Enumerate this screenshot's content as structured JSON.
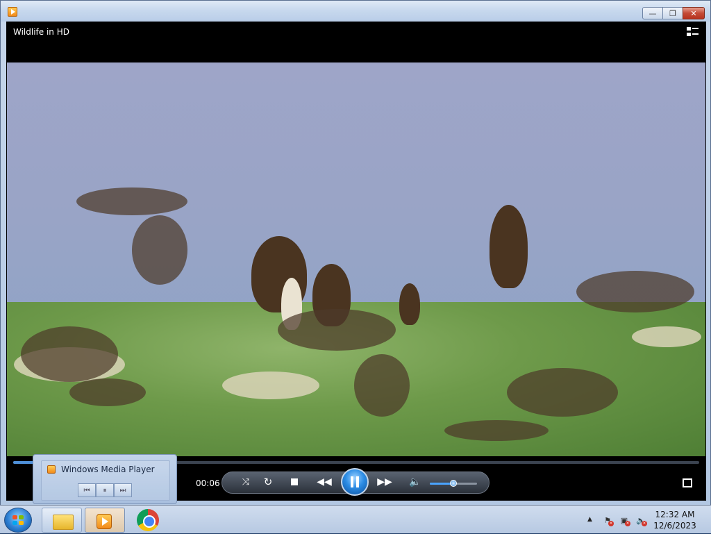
{
  "window": {
    "title": "Wildlife in HD",
    "minimize_label": "—",
    "maximize_label": "❐",
    "close_label": "✕"
  },
  "player": {
    "current_time": "00:06",
    "progress": 0.03,
    "volume": 0.5,
    "icons": [
      "switch-to-library-icon",
      "shuffle-icon",
      "repeat-icon",
      "stop-icon",
      "previous-icon",
      "pause-icon",
      "next-icon",
      "speaker-icon",
      "fullscreen-icon"
    ]
  },
  "thumbnail": {
    "title": "Windows Media Player",
    "prev_label": "⏮",
    "pause_label": "⏸",
    "next_label": "⏭"
  },
  "taskbar": {
    "clock_time": "12:32 AM",
    "clock_date": "12/6/2023"
  },
  "colors": {
    "accent": "#2c8ce5",
    "titlebar": "#c8d9ee",
    "taskbar": "#b7c9e2"
  }
}
